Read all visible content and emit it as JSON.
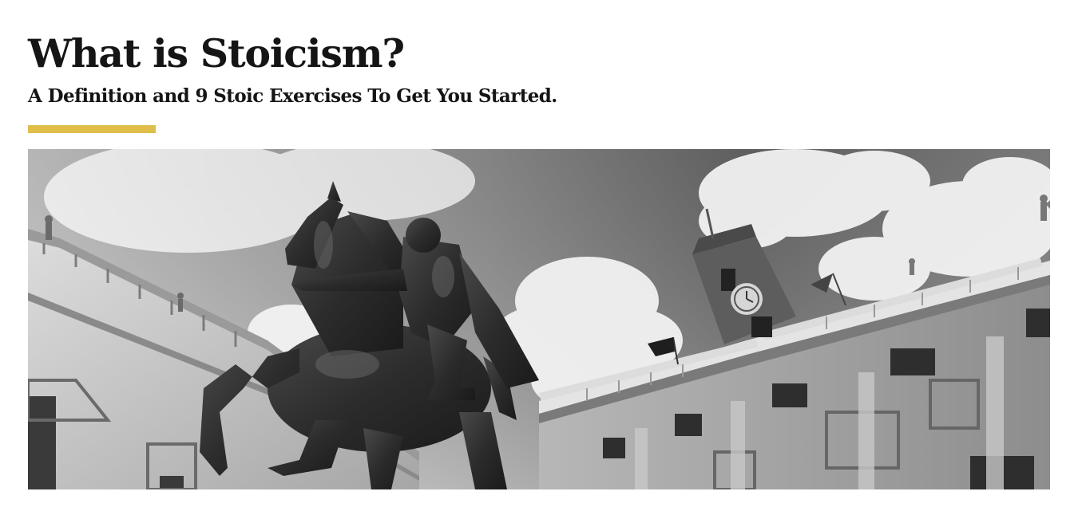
{
  "article": {
    "title": "What is Stoicism?",
    "subtitle": "A Definition and 9 Stoic Exercises To Get You Started."
  },
  "colors": {
    "accent": "#dfbf4a",
    "text": "#151515",
    "background": "#ffffff"
  },
  "hero_image": {
    "icon": "marcus-aurelius-equestrian-statue-photo"
  }
}
